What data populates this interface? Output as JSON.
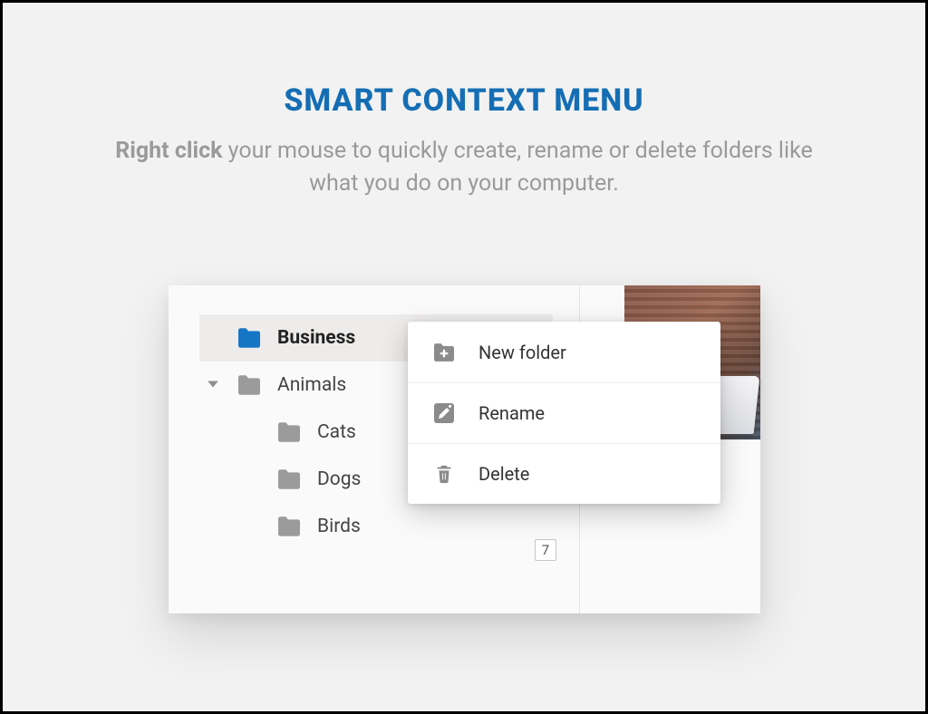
{
  "heading": "SMART CONTEXT MENU",
  "subheading_bold": "Right click",
  "subheading_rest": " your mouse to quickly create, rename or delete folders like what you do on your computer.",
  "tree": {
    "items": [
      {
        "label": "Business",
        "selected": true,
        "depth": 0,
        "expanded": false,
        "color": "#1676c6"
      },
      {
        "label": "Animals",
        "selected": false,
        "depth": 0,
        "expanded": true,
        "color": "#9b9b9b"
      },
      {
        "label": "Cats",
        "selected": false,
        "depth": 1,
        "expanded": false,
        "color": "#9b9b9b"
      },
      {
        "label": "Dogs",
        "selected": false,
        "depth": 1,
        "expanded": false,
        "color": "#9b9b9b"
      },
      {
        "label": "Birds",
        "selected": false,
        "depth": 1,
        "expanded": false,
        "color": "#9b9b9b"
      }
    ]
  },
  "context_menu": {
    "items": [
      {
        "label": "New folder",
        "icon": "folder-plus-icon"
      },
      {
        "label": "Rename",
        "icon": "pencil-icon"
      },
      {
        "label": "Delete",
        "icon": "trash-icon"
      }
    ]
  },
  "thumbnail_badge": "7",
  "colors": {
    "accent": "#156eb4",
    "folder_selected": "#1676c6",
    "folder_default": "#9b9b9b"
  }
}
